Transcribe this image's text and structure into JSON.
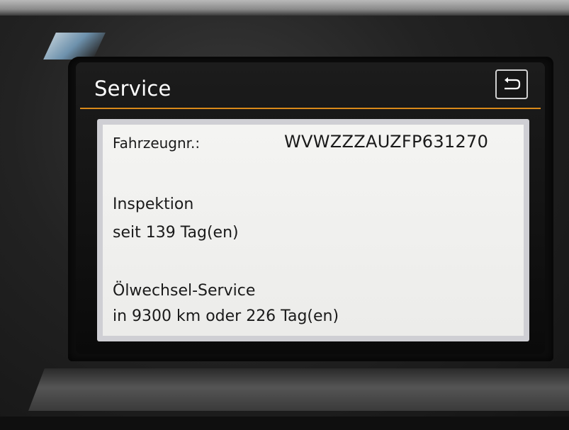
{
  "header": {
    "title": "Service",
    "back_icon": "back-arrow-icon"
  },
  "service_info": {
    "vin_label": "Fahrzeugnr.:",
    "vin_value": "WVWZZZAUZFP631270",
    "inspection_title": "Inspektion",
    "inspection_value": "seit 139 Tag(en)",
    "oil_title": "Ölwechsel-Service",
    "oil_value": "in 9300 km oder 226 Tag(en)"
  },
  "colors": {
    "accent": "#d9891a",
    "screen_bg": "#111111",
    "panel_bg": "#f0f0ee",
    "text": "#1a1a1a"
  }
}
